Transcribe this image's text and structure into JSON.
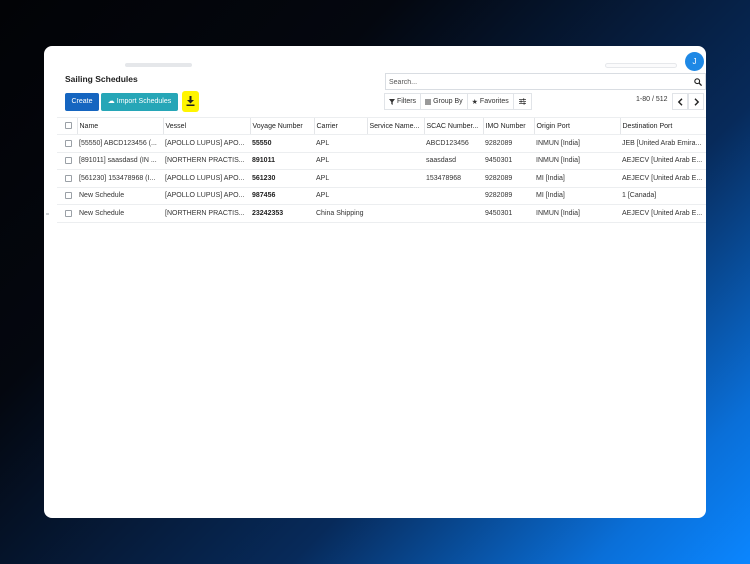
{
  "header": {
    "avatar_initial": "J"
  },
  "page": {
    "title": "Sailing Schedules"
  },
  "toolbar": {
    "create_label": "Create",
    "import_label": "Import Schedules",
    "download_icon": "download-icon",
    "accent_yellow": "#fff500"
  },
  "search": {
    "placeholder": "Search..."
  },
  "filters": {
    "filters_label": "Filters",
    "groupby_label": "Group By",
    "favorites_label": "Favorites"
  },
  "pager": {
    "range": "1-80 / 512"
  },
  "table": {
    "columns": [
      "Name",
      "Vessel",
      "Voyage Number",
      "Carrier",
      "Service Name...",
      "SCAC Number...",
      "IMO Number",
      "Origin Port",
      "Destination Port"
    ],
    "rows": [
      {
        "name": "[55550] ABCD123456 (...",
        "vessel": "[APOLLO LUPUS] APO...",
        "voyage": "55550",
        "carrier": "APL",
        "service": "",
        "scac": "ABCD123456",
        "imo": "9282089",
        "origin": "INMUN [India]",
        "destination": "JEB [United Arab Emira..."
      },
      {
        "name": "[891011] saasdasd (IN ...",
        "vessel": "[NORTHERN PRACTIS...",
        "voyage": "891011",
        "carrier": "APL",
        "service": "",
        "scac": "saasdasd",
        "imo": "9450301",
        "origin": "INMUN [India]",
        "destination": "AEJECV [United Arab E..."
      },
      {
        "name": "[561230] 153478968 (I...",
        "vessel": "[APOLLO LUPUS] APO...",
        "voyage": "561230",
        "carrier": "APL",
        "service": "",
        "scac": "153478968",
        "imo": "9282089",
        "origin": "MI [India]",
        "destination": "AEJECV [United Arab E..."
      },
      {
        "name": "New Schedule",
        "vessel": "[APOLLO LUPUS] APO...",
        "voyage": "987456",
        "carrier": "APL",
        "service": "",
        "scac": "",
        "imo": "9282089",
        "origin": "MI [India]",
        "destination": "1 [Canada]"
      },
      {
        "name": "New Schedule",
        "vessel": "[NORTHERN PRACTIS...",
        "voyage": "23242353",
        "carrier": "China Shipping",
        "service": "",
        "scac": "",
        "imo": "9450301",
        "origin": "INMUN [India]",
        "destination": "AEJECV [United Arab E..."
      }
    ]
  }
}
